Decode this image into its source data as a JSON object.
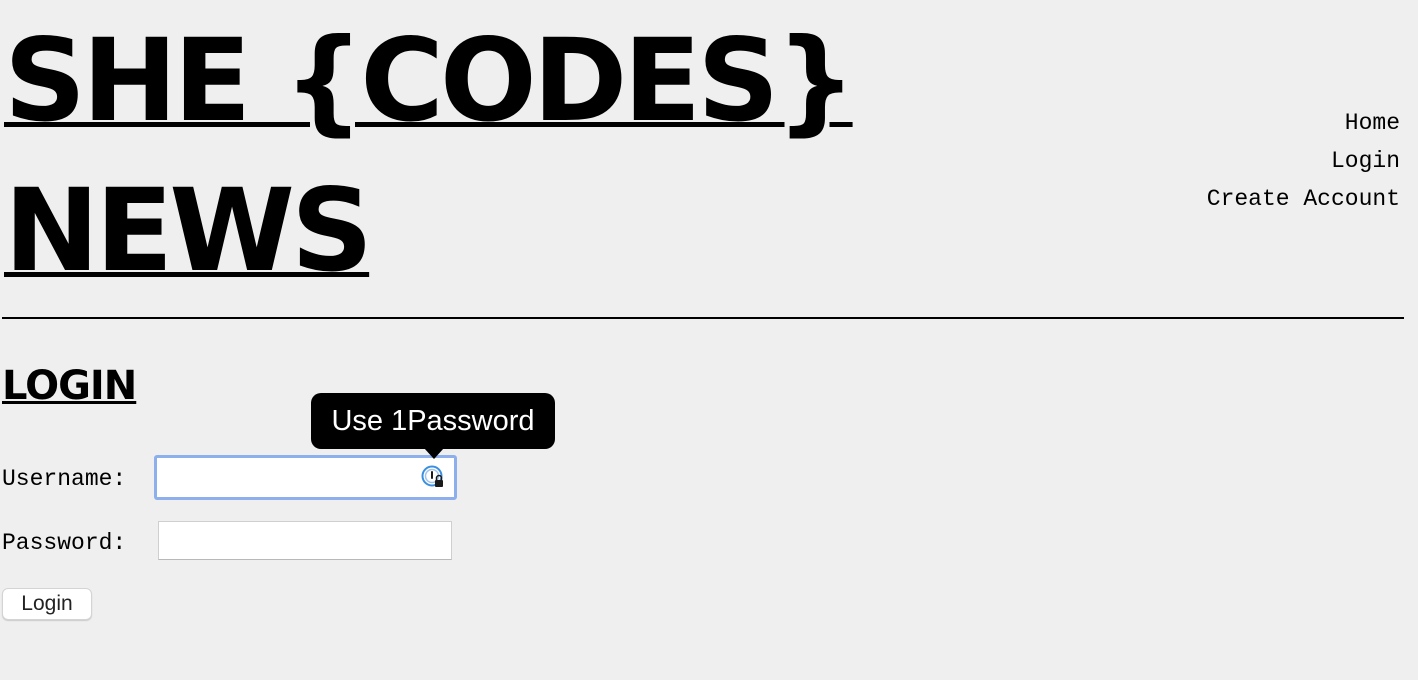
{
  "header": {
    "site_title": "SHE {CODES} NEWS"
  },
  "nav": {
    "items": [
      {
        "label": "Home"
      },
      {
        "label": "Login"
      },
      {
        "label": "Create Account"
      }
    ]
  },
  "main": {
    "heading": "LOGIN",
    "username_label": "Username:",
    "username_value": "",
    "password_label": "Password:",
    "password_value": "",
    "submit_label": "Login"
  },
  "password_manager": {
    "tooltip": "Use 1Password",
    "icon": "1password-icon"
  },
  "colors": {
    "background": "#efefef",
    "focus_ring": "#8db0ec",
    "tooltip_bg": "#000000",
    "onepassword_blue": "#3b8fe0"
  }
}
